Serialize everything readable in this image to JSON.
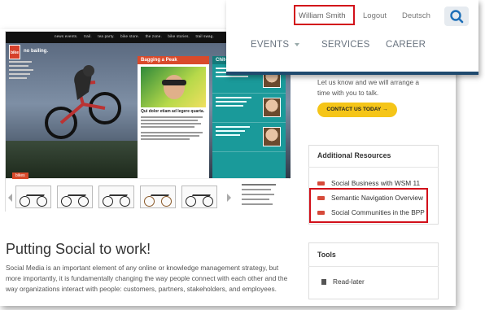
{
  "header": {
    "user_name": "William Smith",
    "logout_label": "Logout",
    "language_label": "Deutsch",
    "search_icon": "search-icon",
    "nav": [
      {
        "label": "EVENTS",
        "has_dropdown": true
      },
      {
        "label": "SERVICES",
        "has_dropdown": false
      },
      {
        "label": "CAREER",
        "has_dropdown": false
      }
    ],
    "accent_color": "#1f4a6e"
  },
  "embedded_site": {
    "top_nav": [
      "news events.",
      "trail.",
      "tea party.",
      "bike store.",
      "the zone.",
      "bike stories.",
      "trail swag."
    ],
    "logo_text": "bike",
    "tagline": "no bailing.",
    "feature_label": "Bagging a Peak",
    "feature_heading": "Qui dolor etiam ad legere quarta.",
    "chat_label": "Chit-Chat",
    "bikes_label": "bikes"
  },
  "article": {
    "title": "Putting Social to work!",
    "body": "Social Media is an important element of any online or knowledge management strategy, but more importantly, it is fundamentally changing the way people connect with each other and the way organizations interact with people: customers, partners, stakeholders, and employees."
  },
  "right_column": {
    "intro_line1": "Let us know and we will arrange a",
    "intro_line2": "time with you to talk.",
    "contact_button": "CONTACT US TODAY →",
    "resources_title": "Additional Resources",
    "resources": [
      {
        "label": "Social Business with WSM 11",
        "highlighted": false
      },
      {
        "label": "Semantic Navigation Overview",
        "highlighted": true
      },
      {
        "label": "Social Communities in the BPP",
        "highlighted": true
      }
    ],
    "tools_title": "Tools",
    "tools": [
      {
        "label": "Read-later"
      }
    ]
  },
  "colors": {
    "highlight": "#d2101a",
    "button": "#f5c518",
    "doc_icon": "#d64a3a"
  }
}
